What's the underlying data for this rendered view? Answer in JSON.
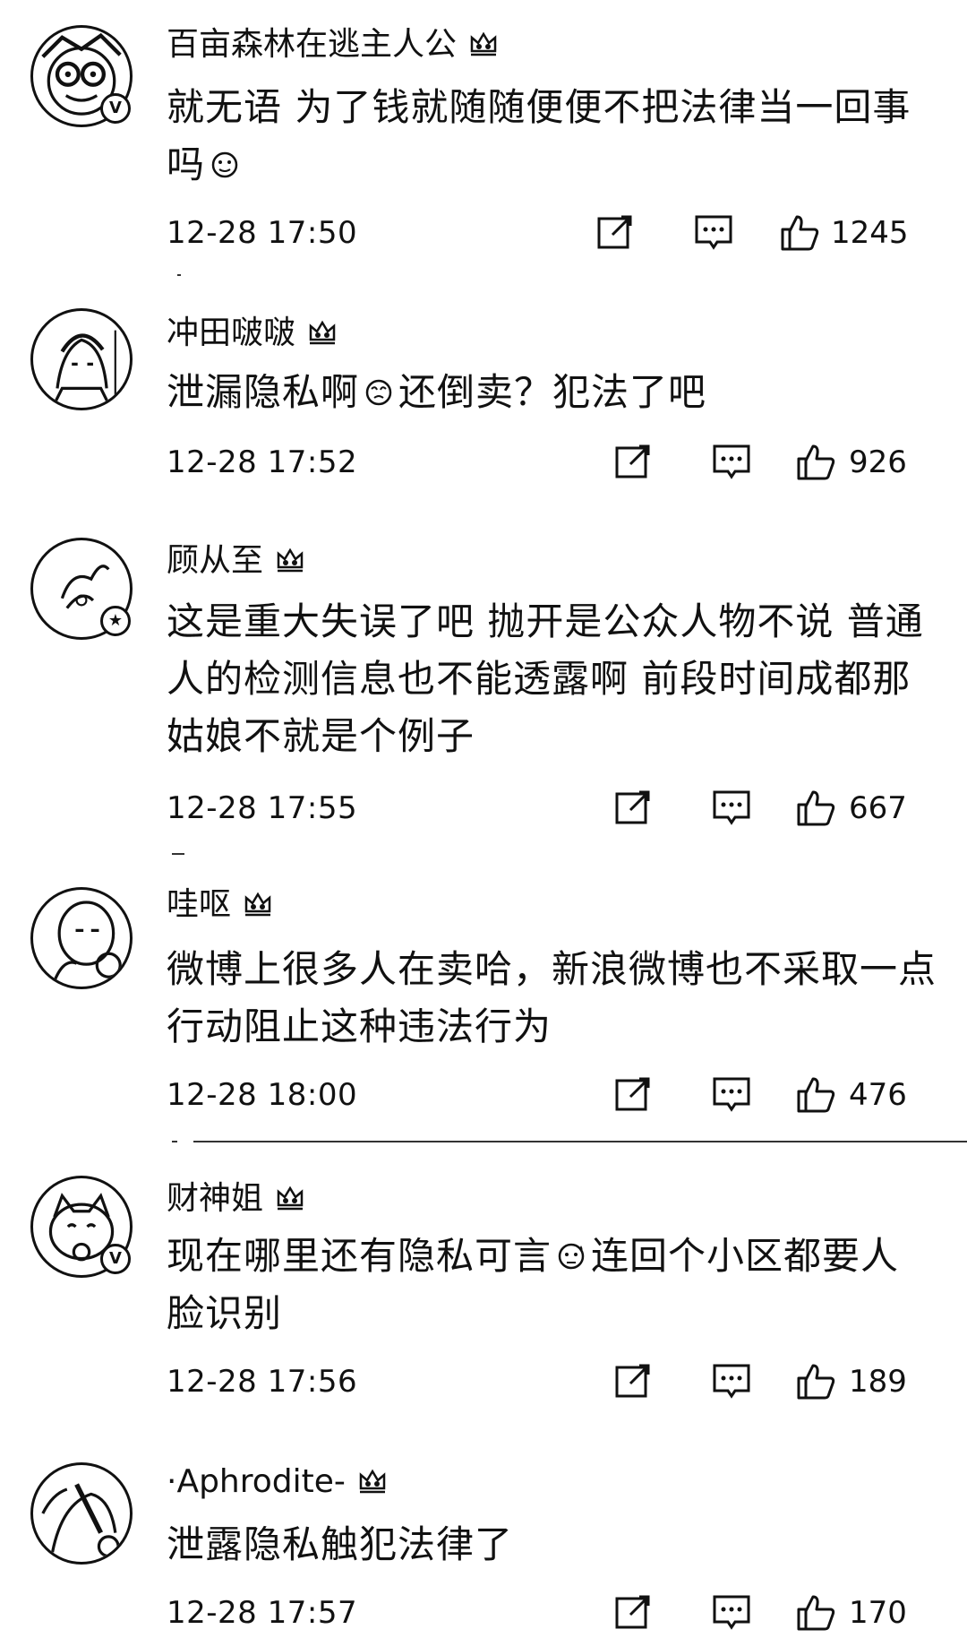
{
  "comments": [
    {
      "username": "百亩森林在逃主人公",
      "text_part1": "就无语 为了钱就随随便便不把法律当一回事吗",
      "emoji": "doge-emoji",
      "text_part2": "",
      "timestamp": "12-28 17:50",
      "likes": "1245",
      "verified": true
    },
    {
      "username": "冲田啵啵",
      "text_part1": "泄漏隐私啊",
      "emoji": "swirl-face-emoji",
      "text_part2": "还倒卖？犯法了吧",
      "timestamp": "12-28 17:52",
      "likes": "926",
      "verified": false
    },
    {
      "username": "顾从至",
      "text_part1": "这是重大失误了吧 抛开是公众人物不说 普通人的检测信息也不能透露啊 前段时间成都那姑娘不就是个例子",
      "emoji": "",
      "text_part2": "",
      "timestamp": "12-28 17:55",
      "likes": "667",
      "verified": false
    },
    {
      "username": "哇呕",
      "text_part1": "微博上很多人在卖哈，新浪微博也不采取一点行动阻止这种违法行为",
      "emoji": "",
      "text_part2": "",
      "timestamp": "12-28 18:00",
      "likes": "476",
      "verified": false
    },
    {
      "username": "财神姐",
      "text_part1": "现在哪里还有隐私可言",
      "emoji": "sweat-face-emoji",
      "text_part2": "连回个小区都要人脸识别",
      "timestamp": "12-28 17:56",
      "likes": "189",
      "verified": true
    },
    {
      "username": "·Aphrodite-",
      "text_part1": "泄露隐私触犯法律了",
      "emoji": "",
      "text_part2": "",
      "timestamp": "12-28 17:57",
      "likes": "170",
      "verified": false
    }
  ],
  "icons": {
    "share": "share-icon",
    "reply": "comment-icon",
    "like": "thumbs-up-icon",
    "rank": "crown-icon"
  },
  "colors": {
    "text": "#111111",
    "background": "#ffffff"
  }
}
